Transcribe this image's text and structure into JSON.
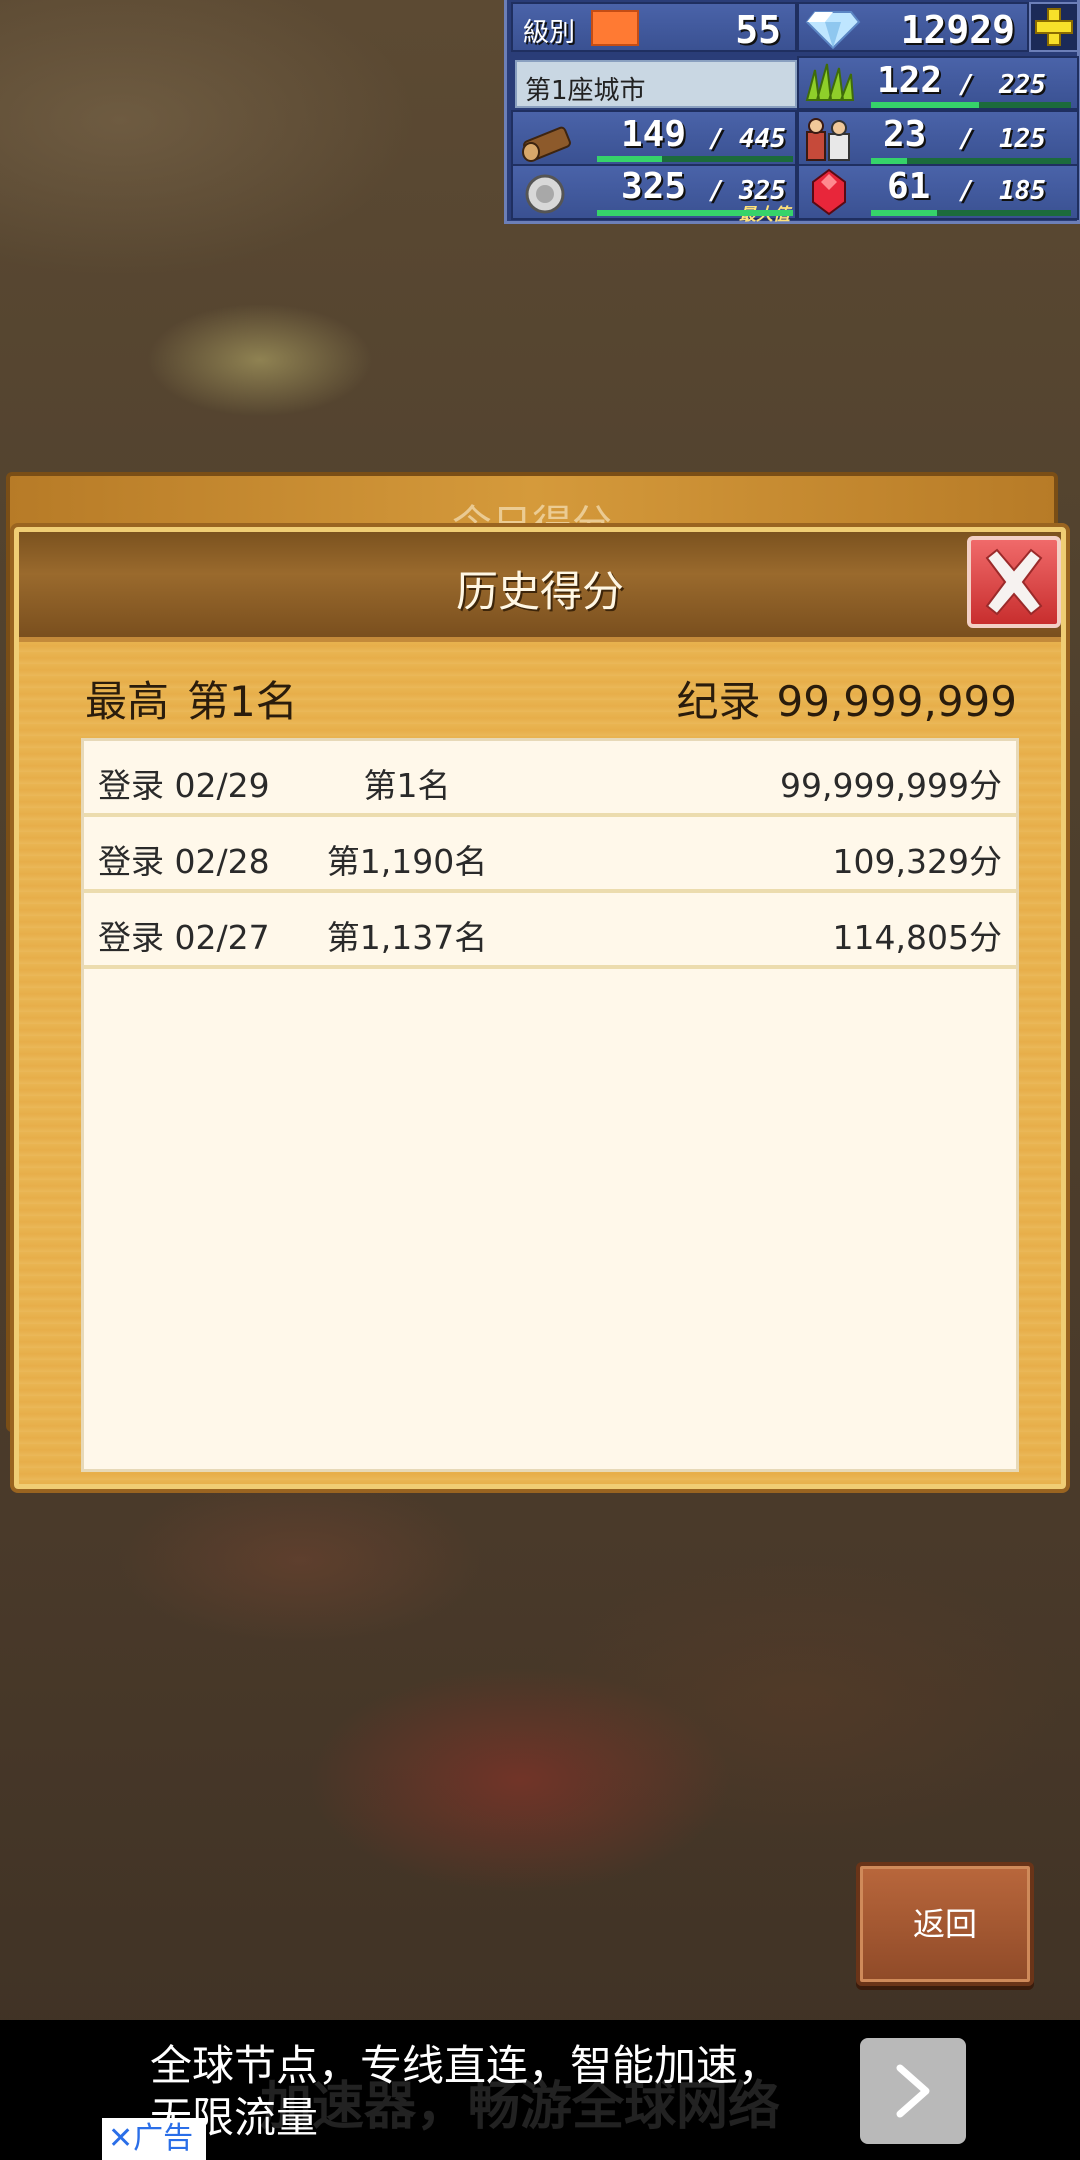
{
  "hud": {
    "level_label": "級別",
    "level": "55",
    "gems": "12929",
    "city_name": "第1座城市",
    "grass": {
      "current": "122",
      "max": "225",
      "fill": 0.54
    },
    "wood": {
      "current": "149",
      "max": "445",
      "fill": 0.33
    },
    "villagers": {
      "current": "23",
      "max": "125",
      "fill": 0.18
    },
    "ore": {
      "current": "325",
      "max": "325",
      "fill": 1.0,
      "max_tag": "最大值"
    },
    "ruby": {
      "current": "61",
      "max": "185",
      "fill": 0.33
    },
    "separator": "/"
  },
  "back_panel": {
    "title": "今日得分"
  },
  "panel": {
    "title": "历史得分",
    "best_label": "最高",
    "best_rank": "第1名",
    "record_label": "纪录",
    "record_value": "99,999,999",
    "rows": [
      {
        "date": "登录 02/29",
        "rank": "第1名",
        "score": "99,999,999分"
      },
      {
        "date": "登录 02/28",
        "rank": "第1,190名",
        "score": "109,329分"
      },
      {
        "date": "登录 02/27",
        "rank": "第1,137名",
        "score": "114,805分"
      }
    ]
  },
  "back_button": "返回",
  "ad": {
    "headline": "全球节点，专线直连，智能加速，无限流量",
    "ghost_text": "加速器，畅游全球网络",
    "badge": "✕广告"
  },
  "icons": {
    "gem": "diamond-icon",
    "plus": "plus-icon",
    "grass": "grass-icon",
    "wood": "log-icon",
    "villagers": "villagers-icon",
    "ore": "ore-icon",
    "ruby": "ruby-icon",
    "close": "close-icon",
    "arrow": "chevron-right-icon"
  },
  "colors": {
    "hud_bg": "#2a3d78",
    "panel_gold": "#e9b552",
    "bar_green": "#36d36a",
    "close_red": "#d83a3a",
    "back_button": "#a65a32"
  }
}
